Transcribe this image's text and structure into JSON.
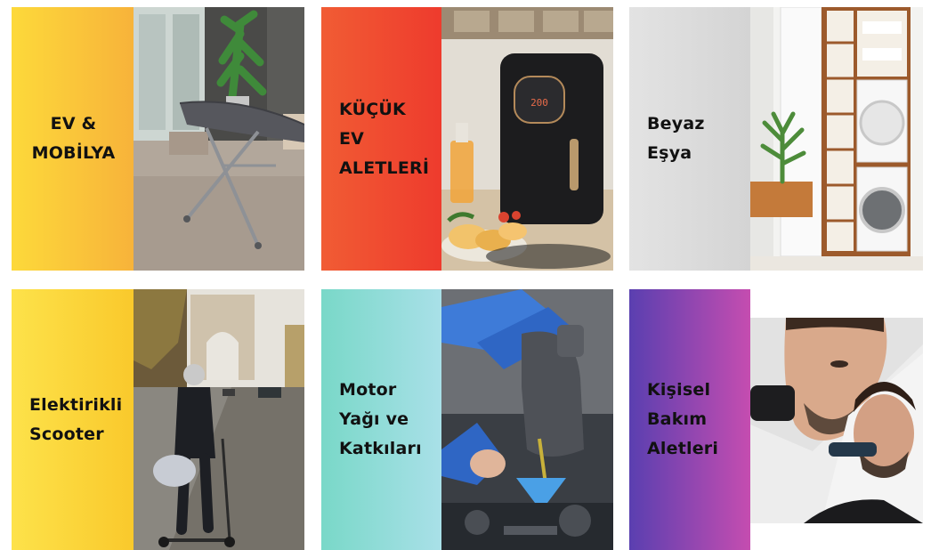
{
  "categories": [
    {
      "lines": [
        "EV  &",
        "MOBİLYA"
      ],
      "gradient": [
        "#fdd93a",
        "#f7b33a"
      ],
      "photo_icon": "ironing-board-photo"
    },
    {
      "lines": [
        "KÜÇÜK",
        "EV",
        "ALETLERİ"
      ],
      "gradient": [
        "#f15c34",
        "#ee3b2d"
      ],
      "photo_icon": "air-fryer-photo",
      "photo_text": "200"
    },
    {
      "lines": [
        "Beyaz",
        "Eşya"
      ],
      "gradient": [
        "#e3e3e3",
        "#d4d4d4"
      ],
      "photo_icon": "laundry-room-photo"
    },
    {
      "lines": [
        "Elektirikli",
        "Scooter"
      ],
      "gradient": [
        "#fde24a",
        "#f9c92c"
      ],
      "photo_icon": "scooter-paris-photo"
    },
    {
      "lines": [
        "Motor",
        "Yağı ve",
        "Katkıları"
      ],
      "gradient": [
        "#79d8c8",
        "#a9e0e8"
      ],
      "photo_icon": "motor-oil-photo"
    },
    {
      "lines": [
        "Kişisel",
        "Bakım",
        "Aletleri"
      ],
      "gradient": [
        "#5a3fb0",
        "#c54db0"
      ],
      "photo_icon": "grooming-trimmer-photo"
    }
  ]
}
